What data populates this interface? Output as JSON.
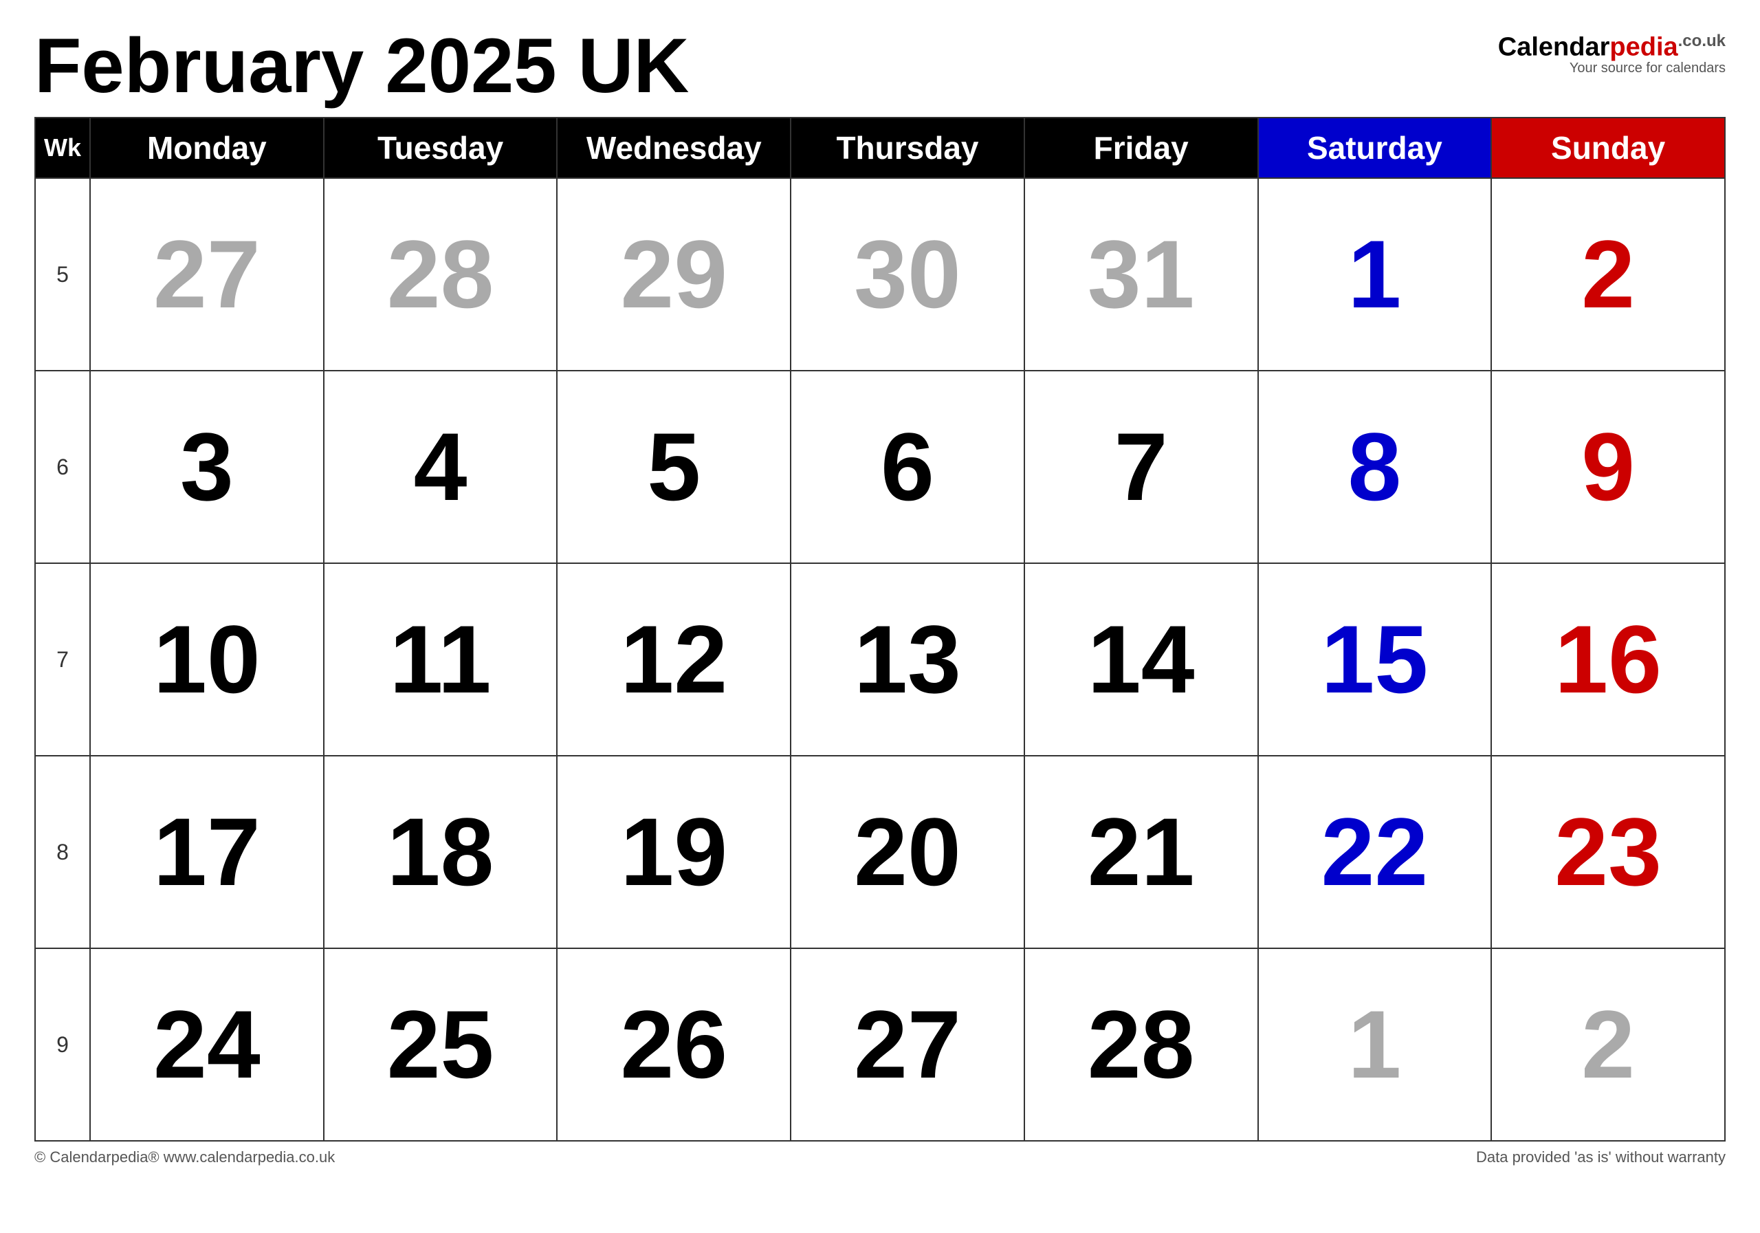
{
  "title": "February 2025 UK",
  "logo": {
    "name": "Calendar",
    "brand": "pedia",
    "tld": ".co.uk",
    "tagline": "Your source for calendars"
  },
  "headers": {
    "wk": "Wk",
    "monday": "Monday",
    "tuesday": "Tuesday",
    "wednesday": "Wednesday",
    "thursday": "Thursday",
    "friday": "Friday",
    "saturday": "Saturday",
    "sunday": "Sunday"
  },
  "weeks": [
    {
      "wk": "5",
      "days": [
        {
          "num": "27",
          "color": "gray"
        },
        {
          "num": "28",
          "color": "gray"
        },
        {
          "num": "29",
          "color": "gray"
        },
        {
          "num": "30",
          "color": "gray"
        },
        {
          "num": "31",
          "color": "gray"
        },
        {
          "num": "1",
          "color": "blue"
        },
        {
          "num": "2",
          "color": "red"
        }
      ]
    },
    {
      "wk": "6",
      "days": [
        {
          "num": "3",
          "color": "black"
        },
        {
          "num": "4",
          "color": "black"
        },
        {
          "num": "5",
          "color": "black"
        },
        {
          "num": "6",
          "color": "black"
        },
        {
          "num": "7",
          "color": "black"
        },
        {
          "num": "8",
          "color": "blue"
        },
        {
          "num": "9",
          "color": "red"
        }
      ]
    },
    {
      "wk": "7",
      "days": [
        {
          "num": "10",
          "color": "black"
        },
        {
          "num": "11",
          "color": "black"
        },
        {
          "num": "12",
          "color": "black"
        },
        {
          "num": "13",
          "color": "black"
        },
        {
          "num": "14",
          "color": "black"
        },
        {
          "num": "15",
          "color": "blue"
        },
        {
          "num": "16",
          "color": "red"
        }
      ]
    },
    {
      "wk": "8",
      "days": [
        {
          "num": "17",
          "color": "black"
        },
        {
          "num": "18",
          "color": "black"
        },
        {
          "num": "19",
          "color": "black"
        },
        {
          "num": "20",
          "color": "black"
        },
        {
          "num": "21",
          "color": "black"
        },
        {
          "num": "22",
          "color": "blue"
        },
        {
          "num": "23",
          "color": "red"
        }
      ]
    },
    {
      "wk": "9",
      "days": [
        {
          "num": "24",
          "color": "black"
        },
        {
          "num": "25",
          "color": "black"
        },
        {
          "num": "26",
          "color": "black"
        },
        {
          "num": "27",
          "color": "black"
        },
        {
          "num": "28",
          "color": "black"
        },
        {
          "num": "1",
          "color": "gray"
        },
        {
          "num": "2",
          "color": "gray"
        }
      ]
    }
  ],
  "footer": {
    "left": "© Calendarpedia®  www.calendarpedia.co.uk",
    "right": "Data provided 'as is' without warranty"
  }
}
